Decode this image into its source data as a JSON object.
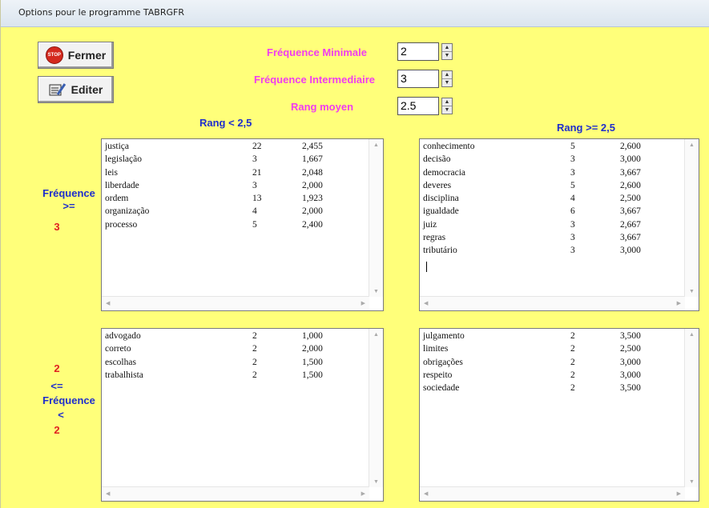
{
  "window": {
    "title": "Options pour le programme TABRGFR"
  },
  "buttons": {
    "close_label": "Fermer",
    "edit_label": "Editer",
    "stop_icon_text": "STOP"
  },
  "controls": {
    "freq_min": {
      "label": "Fréquence Minimale",
      "value": "2"
    },
    "freq_inter": {
      "label": "Fréquence Intermediaire",
      "value": "3"
    },
    "rang_moyen": {
      "label": "Rang moyen",
      "value": "2.5"
    }
  },
  "headers": {
    "left": "Rang < 2,5",
    "right": "Rang >= 2,5"
  },
  "side_top": {
    "l1": "Fréquence",
    "l2": ">=",
    "l3": "3"
  },
  "side_bottom": {
    "l1": "2",
    "l2": "<=",
    "l3": "Fréquence",
    "l4": "<",
    "l5": "2"
  },
  "lists": {
    "top_left": [
      [
        "justiça",
        "22",
        "2,455"
      ],
      [
        "legislação",
        "3",
        "1,667"
      ],
      [
        "leis",
        "21",
        "2,048"
      ],
      [
        "liberdade",
        "3",
        "2,000"
      ],
      [
        "ordem",
        "13",
        "1,923"
      ],
      [
        "organização",
        "4",
        "2,000"
      ],
      [
        "processo",
        "5",
        "2,400"
      ]
    ],
    "top_right": [
      [
        "conhecimento",
        "5",
        "2,600"
      ],
      [
        "decisão",
        "3",
        "3,000"
      ],
      [
        "democracia",
        "3",
        "3,667"
      ],
      [
        "deveres",
        "5",
        "2,600"
      ],
      [
        "disciplina",
        "4",
        "2,500"
      ],
      [
        "igualdade",
        "6",
        "3,667"
      ],
      [
        "juiz",
        "3",
        "2,667"
      ],
      [
        "regras",
        "3",
        "3,667"
      ],
      [
        "tributário",
        "3",
        "3,000"
      ]
    ],
    "bottom_left": [
      [
        "advogado",
        "2",
        "1,000"
      ],
      [
        "correto",
        "2",
        "2,000"
      ],
      [
        "escolhas",
        "2",
        "1,500"
      ],
      [
        "trabalhista",
        "2",
        "1,500"
      ]
    ],
    "bottom_right": [
      [
        "julgamento",
        "2",
        "3,500"
      ],
      [
        "limites",
        "2",
        "2,500"
      ],
      [
        "obrigações",
        "2",
        "3,000"
      ],
      [
        "respeito",
        "2",
        "3,000"
      ],
      [
        "sociedade",
        "2",
        "3,500"
      ]
    ]
  }
}
